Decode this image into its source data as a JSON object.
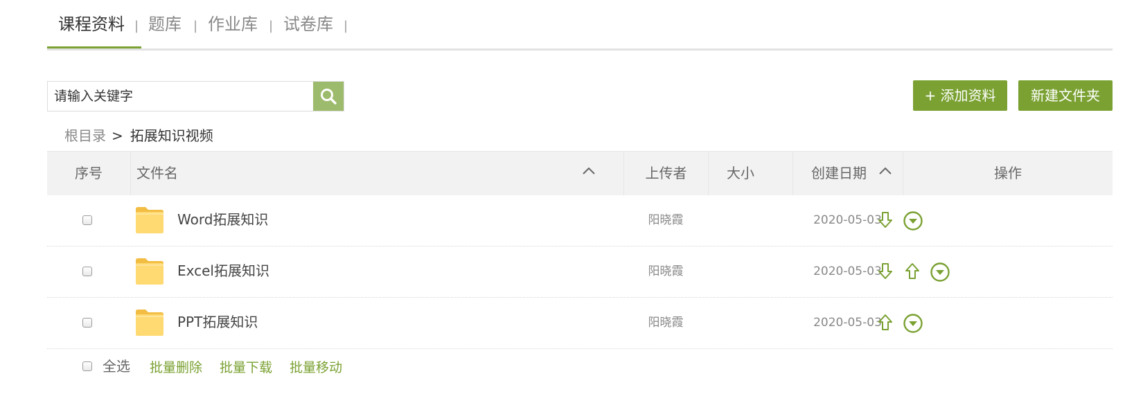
{
  "tabs": [
    {
      "label": "课程资料",
      "active": true
    },
    {
      "label": "题库",
      "active": false
    },
    {
      "label": "作业库",
      "active": false
    },
    {
      "label": "试卷库",
      "active": false
    }
  ],
  "tab_separator": "|",
  "search": {
    "placeholder": "请输入关键字",
    "value": "",
    "button_icon": "search-icon"
  },
  "actions": {
    "add_label": "+ 添加资料",
    "new_folder_label": "新建文件夹"
  },
  "breadcrumb": {
    "root": "根目录",
    "separator": ">",
    "current": "拓展知识视频"
  },
  "table": {
    "headers": {
      "index": "序号",
      "name": "文件名",
      "uploader": "上传者",
      "size": "大小",
      "date": "创建日期",
      "operation": "操作"
    },
    "rows": [
      {
        "checked": false,
        "icon": "folder-icon",
        "name": "Word拓展知识",
        "uploader": "阳晓霞",
        "size": "",
        "date": "2020-05-03",
        "operations": [
          "move-down-icon",
          "more-options-icon"
        ]
      },
      {
        "checked": false,
        "icon": "folder-icon",
        "name": "Excel拓展知识",
        "uploader": "阳晓霞",
        "size": "",
        "date": "2020-05-03",
        "operations": [
          "move-down-icon",
          "move-up-icon",
          "more-options-icon"
        ]
      },
      {
        "checked": false,
        "icon": "folder-icon",
        "name": "PPT拓展知识",
        "uploader": "阳晓霞",
        "size": "",
        "date": "2020-05-03",
        "operations": [
          "move-up-icon",
          "more-options-icon"
        ]
      }
    ]
  },
  "footer": {
    "select_all_label": "全选",
    "batch_delete_label": "批量删除",
    "batch_download_label": "批量下载",
    "batch_move_label": "批量移动"
  },
  "colors": {
    "accent": "#7aa132",
    "search_button": "#9dbb6c",
    "folder": "#ffd56b",
    "header_bg": "#f2f2f2"
  }
}
